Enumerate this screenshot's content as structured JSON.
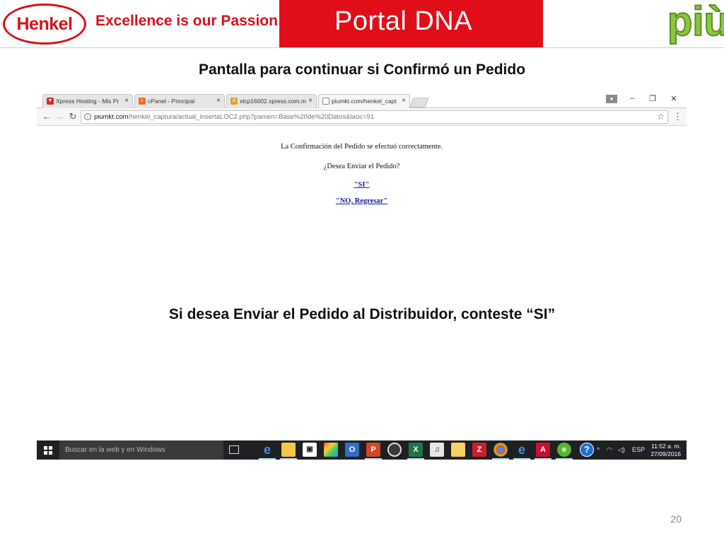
{
  "header": {
    "henkel_logo_text": "Henkel",
    "tagline": "Excellence is our Passion",
    "portal_title": "Portal  DNA",
    "piu_logo_text": "più",
    "brand_red": "#e10d19",
    "piu_green": "#8cc63f"
  },
  "heading_top": "Pantalla para continuar si Confirmó un Pedido",
  "browser": {
    "tabs": [
      {
        "title": "Xpress Hosting - Mis Pr",
        "icon": "xpress-hosting-icon",
        "active": false
      },
      {
        "title": "cPanel - Principal",
        "icon": "cpanel-icon",
        "active": false
      },
      {
        "title": "xlcp16002.xpress.com.m",
        "icon": "server-icon",
        "active": false
      },
      {
        "title": "piumkt.com/henkel_capt",
        "icon": "page-icon",
        "active": true
      }
    ],
    "tab_close_glyph": "×",
    "url_host": "piumkt.com",
    "url_path": "/henkel_captura/actual_insertaLOC2.php?pamen=Base%20de%20Datos&laoc=91",
    "page": {
      "confirmation_text": "La Confirmación del Pedido se efectuó correctamente.",
      "question_text": "¿Desea Enviar el Pedido?",
      "yes_link": "\"SI\"",
      "no_link": "\"NO, Regresar\""
    }
  },
  "heading_bottom": "Si desea Enviar el Pedido al Distribuidor, conteste “SI”",
  "taskbar": {
    "search_placeholder": "Buscar en la web y en Windows",
    "pinned_apps": [
      "edge-icon",
      "file-explorer-icon",
      "store-icon",
      "photos-icon",
      "outlook-icon",
      "powerpoint-icon",
      "camera-icon",
      "excel-icon",
      "media-icon",
      "folder-icon",
      "filezilla-icon",
      "chrome-icon",
      "ie-icon",
      "acrobat-icon",
      "app-green-icon"
    ],
    "help_glyph": "?",
    "language": "ESP",
    "time": "11:52 a. m.",
    "date": "27/09/2016"
  },
  "page_number": "20"
}
